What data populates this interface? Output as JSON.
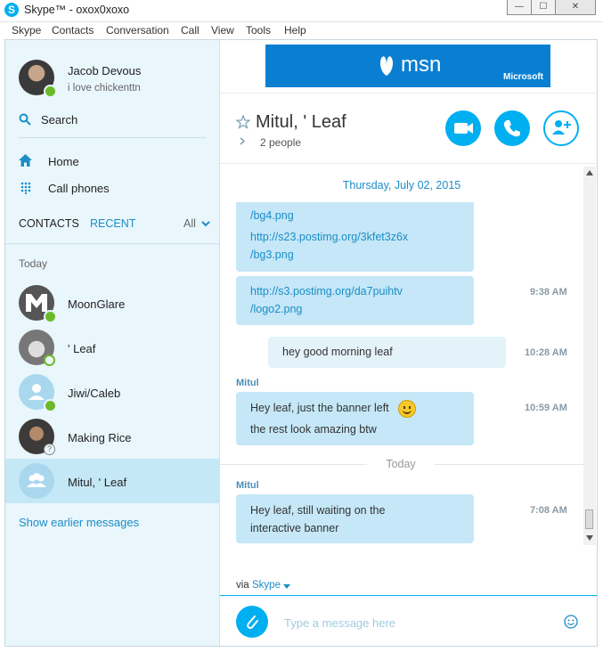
{
  "window": {
    "title": "Skype™ - oxox0xoxo",
    "buttons": {
      "minimize": "—",
      "maximize": "☐",
      "close": "✕"
    }
  },
  "menu": [
    "Skype",
    "Contacts",
    "Conversation",
    "Call",
    "View",
    "Tools",
    "Help"
  ],
  "profile": {
    "name": "Jacob Devous",
    "mood": "i love chickenttn"
  },
  "search": {
    "label": "Search"
  },
  "nav": {
    "home": "Home",
    "call_phones": "Call phones"
  },
  "tabs": {
    "contacts": "CONTACTS",
    "recent": "RECENT",
    "filter": "All"
  },
  "recent_section": "Today",
  "contacts": [
    {
      "name": "MoonGlare",
      "status": "online"
    },
    {
      "name": "' Leaf",
      "status": "away"
    },
    {
      "name": "Jiwi/Caleb",
      "status": "online"
    },
    {
      "name": "Making Rice",
      "status": "unknown"
    },
    {
      "name": "Mitul, ' Leaf",
      "status": "group"
    }
  ],
  "show_earlier": "Show earlier messages",
  "banner": {
    "brand": "msn",
    "company": "Microsoft"
  },
  "conversation": {
    "name": "Mitul, ' Leaf",
    "participants": "2 people",
    "date_header": "Thursday, July 02, 2015",
    "today_divider": "Today"
  },
  "messages": {
    "m1": {
      "lines": [
        "/bg4.png",
        "http://s23.postimg.org/3kfet3z6x",
        "/bg3.png"
      ],
      "line_top_partial": "http://s23.postimg.org/..."
    },
    "m2": {
      "lines": [
        "http://s3.postimg.org/da7puihtv",
        "/logo2.png"
      ],
      "time": "9:38 AM"
    },
    "m3": {
      "text": "hey good morning leaf",
      "time": "10:28 AM"
    },
    "m4": {
      "sender": "Mitul",
      "lines": [
        "Hey leaf, just the banner left",
        "the rest look amazing btw"
      ],
      "time": "10:59 AM"
    },
    "m5": {
      "sender": "Mitul",
      "lines": [
        "Hey leaf, still waiting on the",
        "interactive banner"
      ],
      "time": "7:08 AM"
    }
  },
  "via": {
    "prefix": "via",
    "service": "Skype"
  },
  "composer": {
    "placeholder": "Type a message here"
  },
  "colors": {
    "accent": "#00aff0",
    "sidebar_bg": "#e9f6fc",
    "bubble": "#c5e7f7",
    "online": "#6cba2a"
  }
}
